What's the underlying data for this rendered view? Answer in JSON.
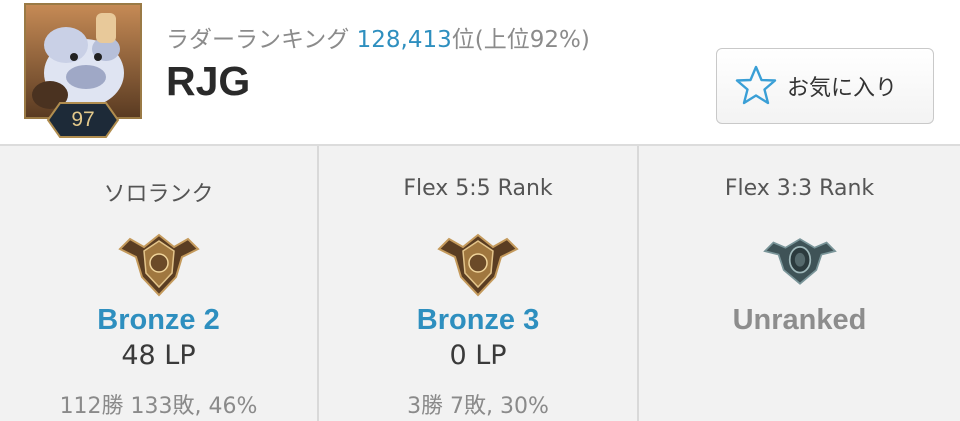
{
  "profile": {
    "level": "97",
    "ladder_label": "ラダーランキング",
    "ladder_rank": "128,413",
    "ladder_suffix": "位(上位92%)",
    "summoner_name": "RJG",
    "favorite_label": "お気に入り",
    "favorite_icon": "star-outline-icon"
  },
  "ranks": [
    {
      "queue": "ソロランク",
      "tier": "Bronze 2",
      "lp": "48 LP",
      "record": "112勝 133敗, 46%",
      "emblem": "bronze-emblem-icon"
    },
    {
      "queue": "Flex 5:5 Rank",
      "tier": "Bronze 3",
      "lp": "0 LP",
      "record": "3勝 7敗, 30%",
      "emblem": "bronze-emblem-icon"
    },
    {
      "queue": "Flex 3:3 Rank",
      "tier": "Unranked",
      "emblem": "unranked-emblem-icon"
    }
  ],
  "colors": {
    "accent": "#2e8fbf",
    "unranked": "#8d8d8d",
    "bronze": "#a0773f"
  }
}
